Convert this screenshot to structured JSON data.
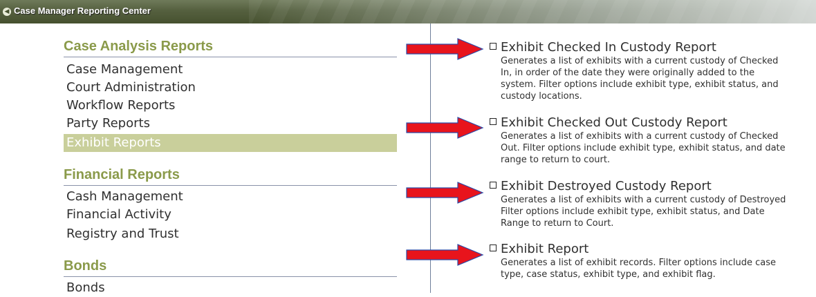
{
  "window": {
    "title": "Case Manager Reporting Center",
    "collapse_glyph": "◀"
  },
  "sidebar": {
    "sections": [
      {
        "heading": "Case Analysis Reports",
        "items": [
          {
            "label": "Case Management",
            "active": false
          },
          {
            "label": "Court Administration",
            "active": false
          },
          {
            "label": "Workflow Reports",
            "active": false
          },
          {
            "label": "Party Reports",
            "active": false
          },
          {
            "label": "Exhibit Reports",
            "active": true
          }
        ]
      },
      {
        "heading": "Financial Reports",
        "items": [
          {
            "label": "Cash Management",
            "active": false
          },
          {
            "label": "Financial Activity",
            "active": false
          },
          {
            "label": "Registry and Trust",
            "active": false
          }
        ]
      },
      {
        "heading": "Bonds",
        "items": [
          {
            "label": "Bonds",
            "active": false
          }
        ]
      }
    ]
  },
  "reports": [
    {
      "title": "Exhibit Checked In Custody Report",
      "description_lines": [
        "Generates a list of exhibits with a current custody of Checked",
        "In, in order of the date they were originally added to the",
        "system. Filter options include exhibit type, exhibit status, and",
        "custody locations."
      ]
    },
    {
      "title": "Exhibit Checked Out Custody Report",
      "description_lines": [
        "Generates a list of exhibits with a current custody of Checked",
        "Out. Filter options include exhibit type, exhibit status, and date",
        "range to return to court."
      ]
    },
    {
      "title": "Exhibit Destroyed Custody Report",
      "description_lines": [
        "Generates a list of exhibits with a current custody of Destroyed",
        "Filter options include exhibit type, exhibit status, and Date",
        "Range to return to Court."
      ]
    },
    {
      "title": "Exhibit Report",
      "description_lines": [
        "Generates a list of exhibit records. Filter options include case",
        "type, case status, exhibit type, and exhibit flag."
      ]
    }
  ],
  "colors": {
    "section_heading": "#8a9a4a",
    "active_item_bg": "#c9cf9b",
    "arrow_red": "#e8141c",
    "arrow_blue_outline": "#2a4aa8"
  }
}
